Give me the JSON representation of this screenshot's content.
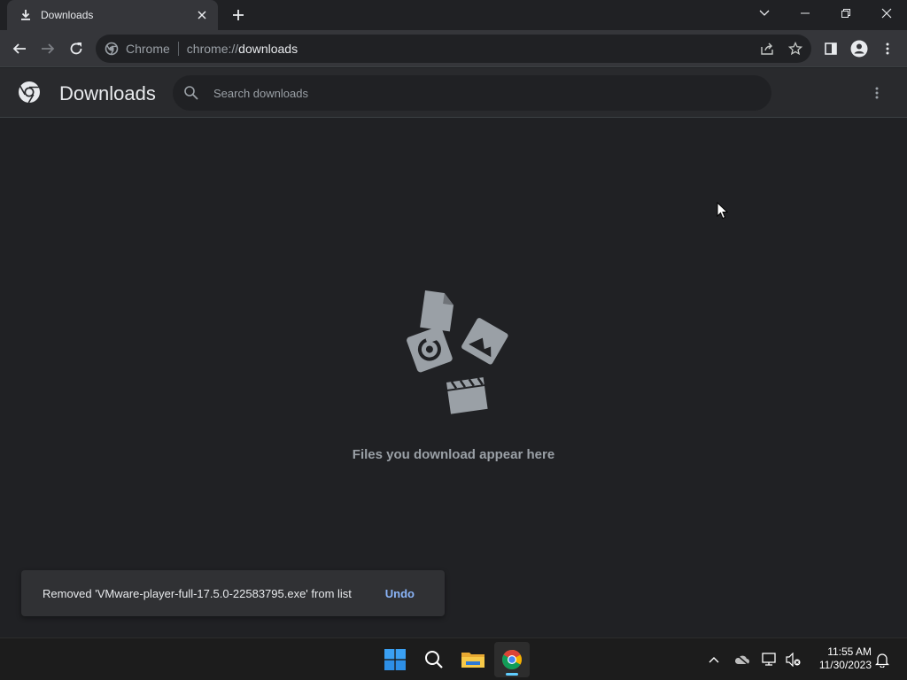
{
  "tab": {
    "title": "Downloads",
    "close_label": "×"
  },
  "omnibox": {
    "site_name": "Chrome",
    "url_scheme": "chrome://",
    "url_path": "downloads"
  },
  "downloads": {
    "title": "Downloads",
    "search_placeholder": "Search downloads",
    "empty_message": "Files you download appear here"
  },
  "toast": {
    "message": "Removed 'VMware-player-full-17.5.0-22583795.exe' from list",
    "action": "Undo"
  },
  "taskbar": {
    "time": "11:55 AM",
    "date": "11/30/2023",
    "apps": [
      "start-icon",
      "search-icon",
      "file-explorer-icon",
      "chrome-icon"
    ]
  },
  "colors": {
    "background": "#202124",
    "toolbar": "#35363a",
    "accent": "#8ab4f8",
    "taskbar": "#1c1c1c"
  }
}
